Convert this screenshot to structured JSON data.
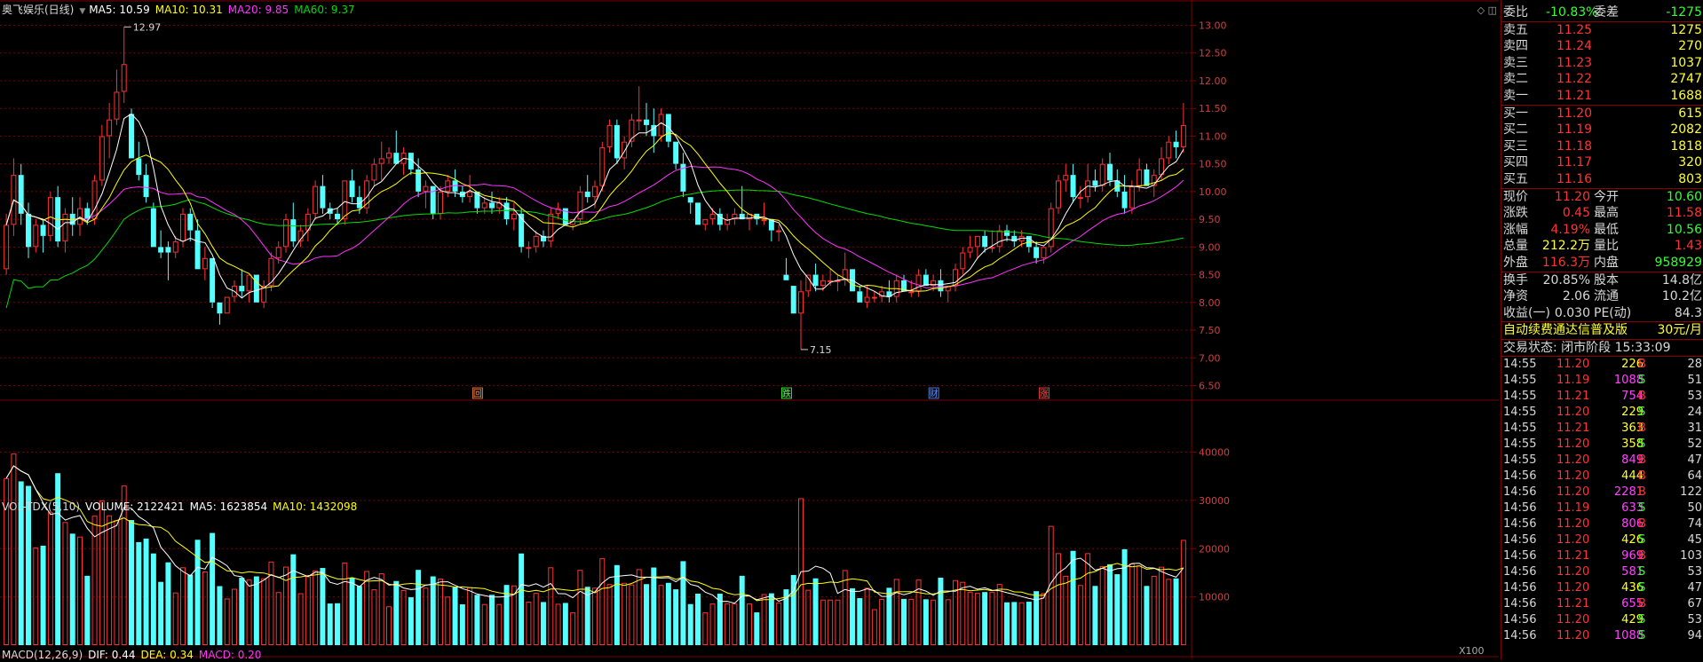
{
  "main_legend": {
    "title": "奥飞娱乐(日线)",
    "ma5": "MA5: 10.59",
    "ma10": "MA10: 10.31",
    "ma20": "MA20: 9.85",
    "ma60": "MA60: 9.37"
  },
  "volume_legend": {
    "title": "VOL-TDX(5,10)",
    "volume": "VOLUME: 2122421",
    "ma5": "MA5: 1623854",
    "ma10": "MA10: 1432098"
  },
  "macd_legend": {
    "title": "MACD(12,26,9)",
    "dif": "DIF: 0.44",
    "dea": "DEA: 0.34",
    "macd": "MACD: 0.20"
  },
  "volume_unit": "X100",
  "colors": {
    "up": "#ff3232",
    "down": "#54ffff",
    "ma5": "#ffffff",
    "ma10": "#ffff00",
    "ma20": "#ff33ff",
    "ma60": "#00dd00",
    "grid": "#7a0000",
    "axis_text": "#d04040"
  },
  "chart_data": [
    {
      "type": "candlestick",
      "title": "奥飞娱乐(日线)",
      "ylim": [
        6.3,
        13.2
      ],
      "yticks": [
        "13.00",
        "12.50",
        "12.00",
        "11.50",
        "11.00",
        "10.50",
        "10.00",
        "9.50",
        "9.00",
        "8.50",
        "8.00",
        "7.50",
        "7.00",
        "6.50"
      ],
      "annotations": [
        {
          "text": "12.97",
          "bar": 16,
          "value": 12.97
        },
        {
          "text": "7.15",
          "bar": 108,
          "value": 7.15
        }
      ],
      "event_markers": [
        {
          "label": "回",
          "bar": 64,
          "color": "#ff8040"
        },
        {
          "label": "跌",
          "bar": 106,
          "color": "#44ff44"
        },
        {
          "label": "财",
          "bar": 126,
          "color": "#5588ff"
        },
        {
          "label": "涨",
          "bar": 141,
          "color": "#ff4444"
        }
      ],
      "ohlc": [
        [
          8.6,
          9.6,
          8.5,
          9.4
        ],
        [
          9.4,
          10.6,
          9.2,
          10.3
        ],
        [
          10.3,
          10.5,
          9.4,
          9.6
        ],
        [
          9.6,
          9.8,
          8.8,
          9.0
        ],
        [
          9.0,
          9.5,
          8.9,
          9.4
        ],
        [
          9.4,
          9.5,
          8.9,
          9.2
        ],
        [
          9.2,
          10.0,
          9.1,
          9.9
        ],
        [
          9.9,
          10.1,
          9.0,
          9.1
        ],
        [
          9.1,
          9.7,
          8.9,
          9.6
        ],
        [
          9.6,
          9.9,
          9.2,
          9.4
        ],
        [
          9.4,
          9.9,
          9.2,
          9.7
        ],
        [
          9.7,
          9.8,
          9.4,
          9.5
        ],
        [
          9.5,
          10.3,
          9.4,
          10.2
        ],
        [
          10.2,
          11.2,
          10.1,
          11.0
        ],
        [
          11.0,
          11.6,
          10.6,
          11.3
        ],
        [
          11.3,
          12.2,
          11.2,
          11.8
        ],
        [
          11.8,
          12.97,
          11.6,
          12.3
        ],
        [
          11.4,
          11.5,
          10.6,
          10.6
        ],
        [
          10.6,
          10.9,
          10.2,
          10.3
        ],
        [
          10.3,
          10.5,
          9.8,
          9.9
        ],
        [
          9.7,
          9.8,
          9.0,
          9.0
        ],
        [
          9.0,
          9.3,
          8.8,
          8.9
        ],
        [
          9.0,
          9.1,
          8.4,
          8.9
        ],
        [
          8.9,
          9.2,
          8.8,
          9.1
        ],
        [
          9.1,
          9.7,
          9.0,
          9.6
        ],
        [
          9.6,
          9.7,
          9.1,
          9.3
        ],
        [
          9.3,
          9.5,
          8.6,
          8.6
        ],
        [
          8.6,
          9.0,
          8.4,
          8.8
        ],
        [
          8.8,
          8.8,
          7.9,
          8.0
        ],
        [
          8.0,
          8.0,
          7.6,
          7.8
        ],
        [
          7.8,
          8.1,
          7.8,
          8.1
        ],
        [
          8.1,
          8.4,
          8.0,
          8.3
        ],
        [
          8.3,
          8.6,
          8.1,
          8.2
        ],
        [
          8.2,
          8.5,
          8.0,
          8.5
        ],
        [
          8.5,
          8.5,
          8.0,
          8.0
        ],
        [
          8.0,
          8.4,
          7.9,
          8.3
        ],
        [
          8.3,
          8.9,
          8.2,
          8.8
        ],
        [
          8.8,
          9.1,
          8.7,
          9.0
        ],
        [
          9.0,
          9.6,
          8.9,
          9.5
        ],
        [
          9.5,
          9.8,
          9.0,
          9.1
        ],
        [
          9.1,
          9.4,
          9.0,
          9.3
        ],
        [
          9.3,
          9.7,
          9.1,
          9.6
        ],
        [
          9.6,
          10.2,
          9.5,
          10.1
        ],
        [
          10.1,
          10.3,
          9.6,
          9.7
        ],
        [
          9.7,
          9.8,
          9.5,
          9.6
        ],
        [
          9.6,
          9.7,
          9.4,
          9.5
        ],
        [
          9.5,
          10.2,
          9.4,
          10.2
        ],
        [
          10.2,
          10.4,
          9.8,
          9.9
        ],
        [
          9.9,
          10.1,
          9.6,
          9.7
        ],
        [
          9.7,
          10.3,
          9.6,
          10.2
        ],
        [
          10.2,
          10.6,
          10.1,
          10.5
        ],
        [
          10.5,
          10.9,
          10.2,
          10.6
        ],
        [
          10.6,
          10.8,
          10.5,
          10.7
        ],
        [
          10.7,
          11.1,
          10.5,
          10.5
        ],
        [
          10.5,
          10.8,
          10.3,
          10.7
        ],
        [
          10.7,
          10.7,
          10.3,
          10.4
        ],
        [
          10.4,
          10.6,
          9.9,
          10.0
        ],
        [
          10.0,
          10.2,
          9.7,
          10.1
        ],
        [
          10.1,
          10.1,
          9.5,
          9.6
        ],
        [
          9.6,
          10.1,
          9.5,
          10.0
        ],
        [
          10.0,
          10.3,
          9.9,
          10.2
        ],
        [
          10.2,
          10.4,
          9.9,
          10.0
        ],
        [
          10.0,
          10.1,
          9.8,
          9.9
        ],
        [
          9.9,
          10.3,
          9.8,
          10.0
        ],
        [
          10.0,
          10.0,
          9.6,
          9.7
        ],
        [
          9.7,
          9.9,
          9.6,
          9.8
        ],
        [
          9.8,
          10.0,
          9.6,
          9.7
        ],
        [
          9.7,
          9.9,
          9.6,
          9.8
        ],
        [
          9.8,
          9.9,
          9.4,
          9.5
        ],
        [
          9.5,
          9.8,
          9.3,
          9.6
        ],
        [
          9.6,
          9.7,
          8.9,
          9.0
        ],
        [
          9.0,
          9.1,
          8.8,
          9.0
        ],
        [
          9.0,
          9.3,
          8.9,
          9.2
        ],
        [
          9.2,
          9.3,
          9.0,
          9.1
        ],
        [
          9.1,
          9.7,
          9.0,
          9.6
        ],
        [
          9.6,
          9.8,
          9.5,
          9.7
        ],
        [
          9.7,
          9.7,
          9.4,
          9.4
        ],
        [
          9.4,
          9.5,
          9.3,
          9.5
        ],
        [
          9.5,
          10.1,
          9.4,
          10.0
        ],
        [
          10.0,
          10.3,
          9.8,
          9.9
        ],
        [
          9.9,
          10.2,
          9.7,
          10.1
        ],
        [
          10.1,
          10.9,
          10.0,
          10.8
        ],
        [
          10.8,
          11.3,
          10.7,
          11.2
        ],
        [
          11.2,
          11.3,
          10.5,
          10.6
        ],
        [
          10.6,
          11.0,
          10.4,
          10.9
        ],
        [
          10.9,
          11.4,
          10.8,
          11.3
        ],
        [
          11.3,
          11.9,
          11.1,
          11.3
        ],
        [
          11.3,
          11.6,
          11.0,
          11.2
        ],
        [
          11.2,
          11.5,
          10.7,
          11.0
        ],
        [
          11.0,
          11.5,
          10.9,
          11.4
        ],
        [
          11.4,
          11.4,
          10.8,
          10.9
        ],
        [
          10.9,
          10.9,
          10.4,
          10.5
        ],
        [
          10.5,
          10.7,
          9.9,
          10.0
        ],
        [
          9.9,
          9.9,
          9.6,
          9.8
        ],
        [
          9.8,
          9.8,
          9.4,
          9.4
        ],
        [
          9.4,
          9.5,
          9.3,
          9.5
        ],
        [
          9.5,
          9.7,
          9.4,
          9.6
        ],
        [
          9.6,
          9.7,
          9.3,
          9.4
        ],
        [
          9.4,
          9.6,
          9.3,
          9.5
        ],
        [
          9.5,
          9.7,
          9.4,
          9.6
        ],
        [
          9.6,
          10.1,
          9.5,
          9.5
        ],
        [
          9.5,
          9.6,
          9.3,
          9.6
        ],
        [
          9.6,
          9.6,
          9.4,
          9.5
        ],
        [
          9.5,
          9.8,
          9.4,
          9.5
        ],
        [
          9.5,
          9.5,
          9.1,
          9.3
        ],
        [
          9.3,
          9.4,
          9.1,
          9.3
        ],
        [
          8.5,
          8.8,
          8.4,
          8.4
        ],
        [
          8.3,
          8.3,
          7.8,
          7.8
        ],
        [
          7.8,
          8.4,
          7.15,
          8.2
        ],
        [
          8.2,
          8.5,
          8.1,
          8.5
        ],
        [
          8.5,
          8.7,
          8.2,
          8.3
        ],
        [
          8.3,
          8.5,
          8.2,
          8.4
        ],
        [
          8.4,
          8.6,
          8.3,
          8.4
        ],
        [
          8.4,
          8.5,
          8.2,
          8.4
        ],
        [
          8.4,
          8.9,
          8.3,
          8.6
        ],
        [
          8.6,
          8.6,
          8.2,
          8.2
        ],
        [
          8.2,
          8.3,
          8.0,
          8.0
        ],
        [
          8.0,
          8.3,
          7.9,
          8.1
        ],
        [
          8.1,
          8.2,
          8.0,
          8.1
        ],
        [
          8.1,
          8.3,
          8.0,
          8.2
        ],
        [
          8.2,
          8.4,
          8.0,
          8.1
        ],
        [
          8.1,
          8.5,
          8.0,
          8.4
        ],
        [
          8.4,
          8.5,
          8.2,
          8.2
        ],
        [
          8.2,
          8.4,
          8.1,
          8.2
        ],
        [
          8.2,
          8.6,
          8.1,
          8.5
        ],
        [
          8.5,
          8.6,
          8.3,
          8.3
        ],
        [
          8.3,
          8.5,
          8.2,
          8.4
        ],
        [
          8.4,
          8.6,
          8.1,
          8.2
        ],
        [
          8.2,
          8.3,
          8.0,
          8.3
        ],
        [
          8.3,
          8.7,
          8.2,
          8.6
        ],
        [
          8.6,
          9.0,
          8.5,
          8.9
        ],
        [
          8.9,
          9.2,
          8.8,
          9.0
        ],
        [
          9.0,
          9.2,
          8.8,
          9.2
        ],
        [
          9.2,
          9.3,
          8.9,
          9.0
        ],
        [
          9.0,
          9.3,
          8.9,
          9.0
        ],
        [
          9.0,
          9.4,
          8.9,
          9.3
        ],
        [
          9.3,
          9.4,
          9.1,
          9.2
        ],
        [
          9.2,
          9.3,
          9.0,
          9.1
        ],
        [
          9.1,
          9.3,
          9.0,
          9.2
        ],
        [
          9.2,
          9.2,
          8.9,
          9.0
        ],
        [
          9.0,
          9.1,
          8.7,
          8.8
        ],
        [
          8.8,
          9.0,
          8.7,
          9.0
        ],
        [
          9.0,
          9.8,
          8.9,
          9.7
        ],
        [
          9.7,
          10.3,
          9.6,
          10.2
        ],
        [
          10.2,
          10.5,
          10.0,
          10.3
        ],
        [
          10.3,
          10.5,
          9.8,
          9.9
        ],
        [
          9.9,
          10.1,
          9.7,
          9.9
        ],
        [
          9.9,
          10.5,
          9.8,
          10.2
        ],
        [
          10.2,
          10.4,
          10.0,
          10.1
        ],
        [
          10.1,
          10.6,
          10.0,
          10.5
        ],
        [
          10.5,
          10.7,
          10.1,
          10.2
        ],
        [
          10.2,
          10.4,
          9.9,
          10.0
        ],
        [
          10.0,
          10.3,
          9.6,
          9.7
        ],
        [
          9.7,
          10.2,
          9.6,
          10.1
        ],
        [
          10.1,
          10.6,
          10.0,
          10.4
        ],
        [
          10.4,
          10.5,
          10.1,
          10.1
        ],
        [
          10.1,
          10.4,
          9.9,
          10.3
        ],
        [
          10.3,
          10.8,
          10.2,
          10.6
        ],
        [
          10.6,
          11.0,
          10.5,
          10.9
        ],
        [
          10.9,
          11.1,
          10.6,
          10.8
        ],
        [
          10.8,
          11.6,
          10.7,
          11.2
        ]
      ]
    },
    {
      "type": "bar",
      "title": "VOL-TDX(5,10)",
      "ylim": [
        0,
        48000
      ],
      "yticks": [
        40000,
        30000,
        20000,
        10000
      ]
    }
  ],
  "quote_panel": {
    "weibi": {
      "label": "委比",
      "ratio": "-10.83%",
      "label2": "委差",
      "diff": "-1275"
    },
    "sells": [
      {
        "label": "卖五",
        "price": "11.25",
        "vol": "1275"
      },
      {
        "label": "卖四",
        "price": "11.24",
        "vol": "270"
      },
      {
        "label": "卖三",
        "price": "11.23",
        "vol": "1037"
      },
      {
        "label": "卖二",
        "price": "11.22",
        "vol": "2747"
      },
      {
        "label": "卖一",
        "price": "11.21",
        "vol": "1688"
      }
    ],
    "buys": [
      {
        "label": "买一",
        "price": "11.20",
        "vol": "615"
      },
      {
        "label": "买二",
        "price": "11.19",
        "vol": "2082"
      },
      {
        "label": "买三",
        "price": "11.18",
        "vol": "1818"
      },
      {
        "label": "买四",
        "price": "11.17",
        "vol": "320"
      },
      {
        "label": "买五",
        "price": "11.16",
        "vol": "803"
      }
    ],
    "stats": [
      {
        "l1": "现价",
        "v1": "11.20",
        "c1": "r",
        "l2": "今开",
        "v2": "10.60",
        "c2": "g"
      },
      {
        "l1": "涨跌",
        "v1": "0.45",
        "c1": "r",
        "l2": "最高",
        "v2": "11.58",
        "c2": "r"
      },
      {
        "l1": "涨幅",
        "v1": "4.19%",
        "c1": "r",
        "l2": "最低",
        "v2": "10.56",
        "c2": "g"
      },
      {
        "l1": "总量",
        "v1": "212.2万",
        "c1": "y",
        "l2": "量比",
        "v2": "1.43",
        "c2": "r"
      },
      {
        "l1": "外盘",
        "v1": "116.3万",
        "c1": "r",
        "l2": "内盘",
        "v2": "958929",
        "c2": "g"
      }
    ],
    "fundamentals": [
      {
        "l1": "换手",
        "v1": "20.85%",
        "l2": "股本",
        "v2": "14.8亿"
      },
      {
        "l1": "净资",
        "v1": "2.06",
        "l2": "流通",
        "v2": "10.2亿"
      },
      {
        "l1": "收益(一)",
        "v1": "0.030",
        "l2": "PE(动)",
        "v2": "84.3"
      }
    ],
    "ad": {
      "text": "自动续费通达信普及版",
      "price": "30元/月"
    },
    "trade_status": "交易状态: 闭市阶段 15:33:09",
    "ticks": [
      {
        "t": "14:55",
        "p": "11.20",
        "v": "226",
        "s": "B",
        "n": "28"
      },
      {
        "t": "14:55",
        "p": "11.19",
        "v": "1088",
        "s": "S",
        "n": "51"
      },
      {
        "t": "14:55",
        "p": "11.21",
        "v": "754",
        "s": "B",
        "n": "53"
      },
      {
        "t": "14:55",
        "p": "11.20",
        "v": "229",
        "s": "S",
        "n": "24"
      },
      {
        "t": "14:55",
        "p": "11.21",
        "v": "363",
        "s": "B",
        "n": "31"
      },
      {
        "t": "14:55",
        "p": "11.20",
        "v": "358",
        "s": "S",
        "n": "52"
      },
      {
        "t": "14:55",
        "p": "11.20",
        "v": "849",
        "s": "B",
        "n": "47"
      },
      {
        "t": "14:56",
        "p": "11.20",
        "v": "444",
        "s": "B",
        "n": "64"
      },
      {
        "t": "14:56",
        "p": "11.20",
        "v": "2281",
        "s": "B",
        "n": "122"
      },
      {
        "t": "14:56",
        "p": "11.19",
        "v": "633",
        "s": "S",
        "n": "50"
      },
      {
        "t": "14:56",
        "p": "11.20",
        "v": "806",
        "s": "B",
        "n": "74"
      },
      {
        "t": "14:56",
        "p": "11.20",
        "v": "426",
        "s": "S",
        "n": "45"
      },
      {
        "t": "14:56",
        "p": "11.21",
        "v": "969",
        "s": "B",
        "n": "103"
      },
      {
        "t": "14:56",
        "p": "11.20",
        "v": "581",
        "s": "S",
        "n": "53"
      },
      {
        "t": "14:56",
        "p": "11.20",
        "v": "436",
        "s": "S",
        "n": "47"
      },
      {
        "t": "14:56",
        "p": "11.21",
        "v": "655",
        "s": "B",
        "n": "67"
      },
      {
        "t": "14:56",
        "p": "11.20",
        "v": "429",
        "s": "S",
        "n": "53"
      },
      {
        "t": "14:56",
        "p": "11.20",
        "v": "1088",
        "s": "S",
        "n": "94"
      }
    ]
  }
}
